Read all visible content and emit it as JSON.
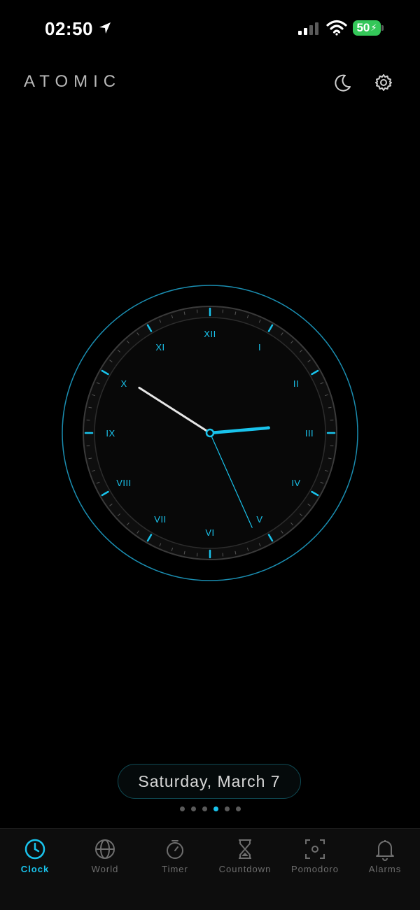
{
  "status_bar": {
    "time": "02:50",
    "battery": "50",
    "icons": [
      "location-arrow-icon",
      "cellular-signal-icon",
      "wifi-icon",
      "battery-charging-icon"
    ]
  },
  "header": {
    "title": "ATOMIC",
    "icons": [
      "moon-icon",
      "gear-icon"
    ]
  },
  "clock": {
    "numerals": [
      "XII",
      "I",
      "II",
      "III",
      "IV",
      "V",
      "VI",
      "VII",
      "VIII",
      "IX",
      "X",
      "XI"
    ],
    "time": {
      "hour": 2,
      "minute": 50,
      "second": 26
    },
    "accent_color": "#19c3ec",
    "minute_hand_color": "#e6e6e6"
  },
  "date": "Saturday, March 7",
  "pager": {
    "count": 6,
    "active_index": 3
  },
  "tabs": [
    {
      "label": "Clock",
      "icon": "clock-icon",
      "active": true
    },
    {
      "label": "World",
      "icon": "globe-icon",
      "active": false
    },
    {
      "label": "Timer",
      "icon": "stopwatch-icon",
      "active": false
    },
    {
      "label": "Countdown",
      "icon": "hourglass-icon",
      "active": false
    },
    {
      "label": "Pomodoro",
      "icon": "focus-icon",
      "active": false
    },
    {
      "label": "Alarms",
      "icon": "bell-icon",
      "active": false
    }
  ],
  "colors": {
    "accent": "#19c3ec",
    "background": "#000000",
    "battery": "#34c759"
  }
}
